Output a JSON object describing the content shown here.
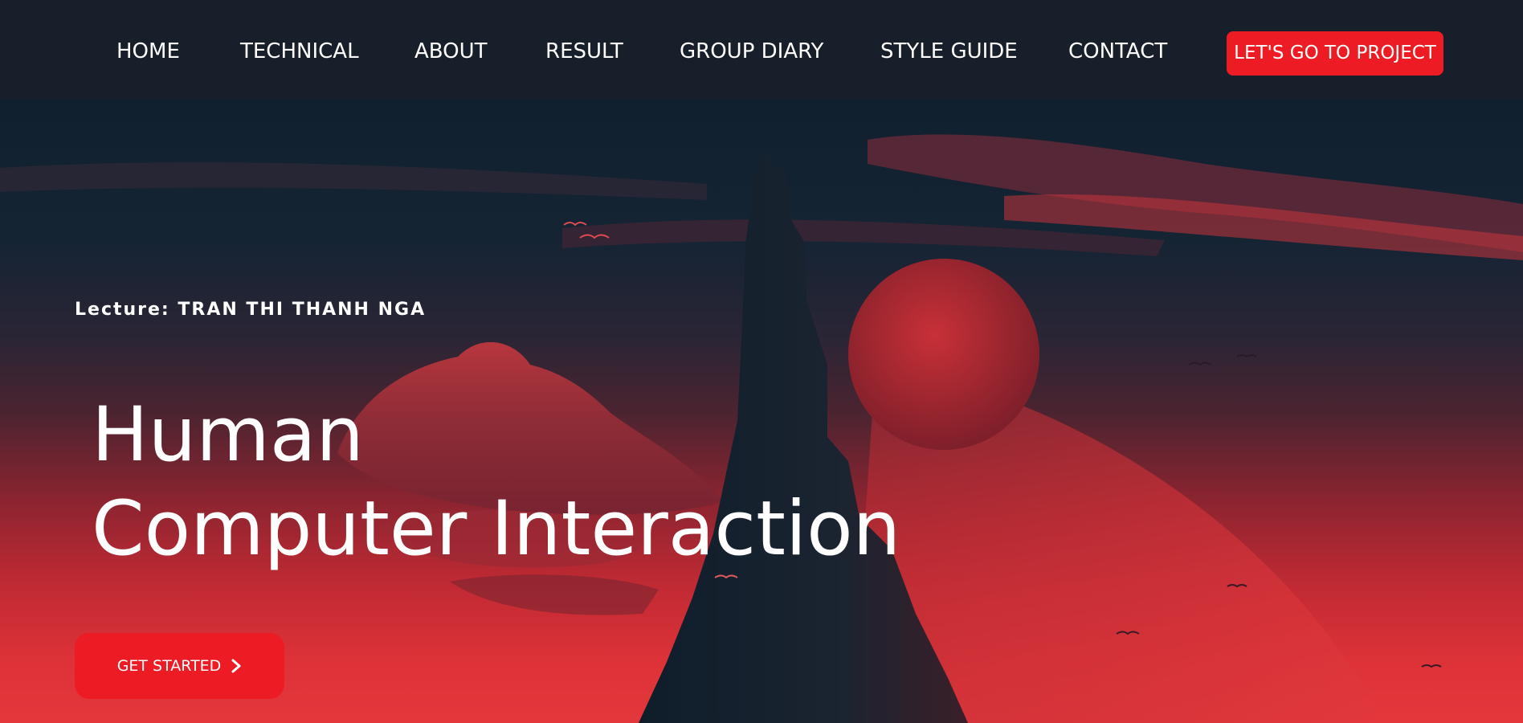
{
  "nav": {
    "items": [
      {
        "label": "HOME"
      },
      {
        "label": "TECHNICAL"
      },
      {
        "label": "ABOUT"
      },
      {
        "label": "RESULT"
      },
      {
        "label": "GROUP DIARY"
      },
      {
        "label": "STYLE GUIDE"
      },
      {
        "label": "CONTACT"
      }
    ],
    "cta_label": "LET'S GO TO PROJECT"
  },
  "hero": {
    "lecture": "Lecture: TRAN THI THANH NGA",
    "title_line1": "Human",
    "title_line2": "Computer Interaction",
    "button_label": "GET STARTED",
    "button_icon": "chevron-right-icon"
  },
  "colors": {
    "accent": "#ec1b24",
    "nav_bg": "#17202a",
    "text": "#ffffff"
  }
}
